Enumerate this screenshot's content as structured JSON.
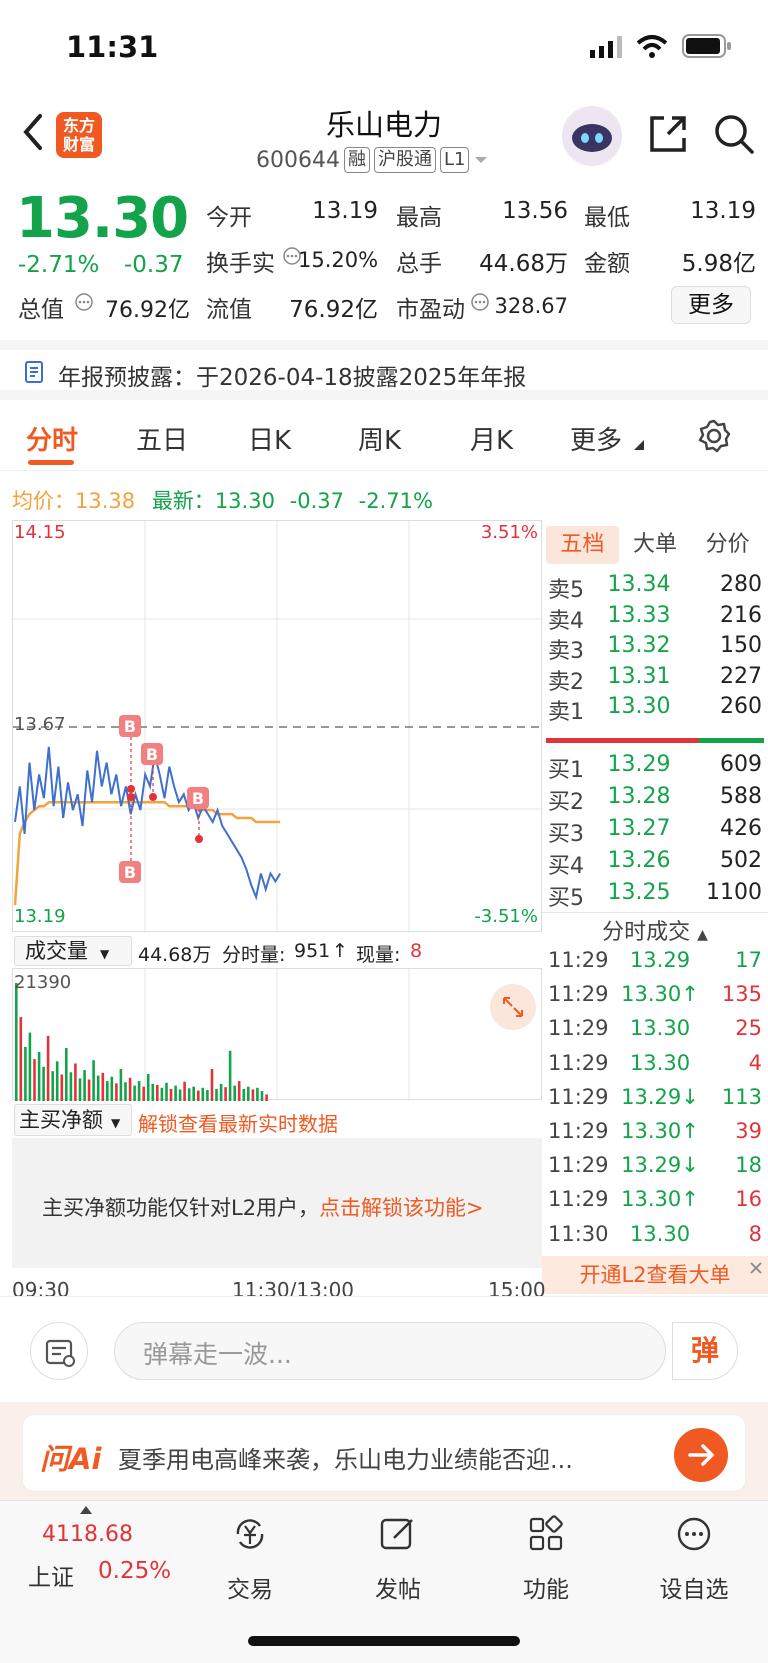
{
  "status": {
    "time": "11:31"
  },
  "header": {
    "logo_line1": "东方",
    "logo_line2": "财富",
    "name": "乐山电力",
    "code": "600644",
    "tags": [
      "融",
      "沪股通",
      "L1"
    ]
  },
  "quote": {
    "price": "13.30",
    "pct": "-2.71%",
    "change": "-0.37",
    "stats": [
      {
        "label": "今开",
        "value": "13.19",
        "color": "#13a34a"
      },
      {
        "label": "最高",
        "value": "13.56",
        "color": "#13a34a"
      },
      {
        "label": "最低",
        "value": "13.19",
        "color": "#13a34a"
      },
      {
        "label": "换手实",
        "value": "15.20%",
        "color": "#222222"
      },
      {
        "label": "总手",
        "value": "44.68万",
        "color": "#222222"
      },
      {
        "label": "金额",
        "value": "5.98亿",
        "color": "#222222"
      },
      {
        "label": "总值",
        "value": "76.92亿",
        "color": "#222222"
      },
      {
        "label": "流值",
        "value": "76.92亿",
        "color": "#222222"
      },
      {
        "label": "市盈动",
        "value": "328.67",
        "color": "#222222"
      }
    ],
    "more": "更多"
  },
  "notice": "年报预披露：于2026-04-18披露2025年年报",
  "tabs": [
    "分时",
    "五日",
    "日K",
    "周K",
    "月K",
    "更多"
  ],
  "avg_row": {
    "avg_label": "均价：",
    "avg_value": "13.38",
    "latest_label": "最新：",
    "latest_value": "13.30",
    "change": "-0.37",
    "pct": "-2.71%"
  },
  "chart_data": {
    "type": "line",
    "y_top": "14.15",
    "y_bottom": "13.19",
    "y_ref": "13.67",
    "pct_top": "3.51%",
    "pct_bottom": "-3.51%",
    "ylim": [
      13.19,
      14.15
    ],
    "x_labels": [
      "09:30",
      "11:30/13:00",
      "15:00"
    ],
    "price_series": [
      13.43,
      13.52,
      13.4,
      13.58,
      13.46,
      13.55,
      13.49,
      13.62,
      13.47,
      13.57,
      13.44,
      13.53,
      13.46,
      13.5,
      13.42,
      13.56,
      13.48,
      13.61,
      13.52,
      13.58,
      13.5,
      13.55,
      13.47,
      13.52,
      13.45,
      13.5,
      13.46,
      13.55,
      13.52,
      13.6,
      13.55,
      13.49,
      13.57,
      13.52,
      13.48,
      13.5,
      13.46,
      13.48,
      13.44,
      13.47,
      13.45,
      13.43,
      13.46,
      13.42,
      13.4,
      13.38,
      13.36,
      13.34,
      13.31,
      13.27,
      13.24,
      13.3,
      13.26,
      13.3,
      13.28,
      13.3
    ],
    "avg_series": [
      13.22,
      13.4,
      13.43,
      13.45,
      13.46,
      13.47,
      13.47,
      13.48,
      13.48,
      13.48,
      13.48,
      13.48,
      13.48,
      13.48,
      13.48,
      13.48,
      13.48,
      13.48,
      13.48,
      13.48,
      13.48,
      13.48,
      13.48,
      13.48,
      13.48,
      13.48,
      13.48,
      13.48,
      13.48,
      13.48,
      13.48,
      13.48,
      13.47,
      13.47,
      13.47,
      13.47,
      13.47,
      13.47,
      13.46,
      13.46,
      13.46,
      13.46,
      13.45,
      13.45,
      13.45,
      13.45,
      13.44,
      13.44,
      13.44,
      13.44,
      13.43,
      13.43,
      13.43,
      13.43,
      13.43,
      13.43
    ],
    "buy_markers": [
      "B",
      "B",
      "B",
      "B"
    ]
  },
  "order_book": {
    "tabs": [
      "五档",
      "大单",
      "分价"
    ],
    "asks": [
      {
        "label": "卖5",
        "price": "13.34",
        "vol": "280"
      },
      {
        "label": "卖4",
        "price": "13.33",
        "vol": "216"
      },
      {
        "label": "卖3",
        "price": "13.32",
        "vol": "150"
      },
      {
        "label": "卖2",
        "price": "13.31",
        "vol": "227"
      },
      {
        "label": "卖1",
        "price": "13.30",
        "vol": "260"
      }
    ],
    "bids": [
      {
        "label": "买1",
        "price": "13.29",
        "vol": "609"
      },
      {
        "label": "买2",
        "price": "13.28",
        "vol": "588"
      },
      {
        "label": "买3",
        "price": "13.27",
        "vol": "426"
      },
      {
        "label": "买4",
        "price": "13.26",
        "vol": "502"
      },
      {
        "label": "买5",
        "price": "13.25",
        "vol": "1100"
      }
    ],
    "ticks_title": "分时成交",
    "ticks": [
      {
        "time": "11:29",
        "price": "13.29",
        "arrow": "",
        "vol": "17",
        "pc": "#13a34a",
        "vc": "#13a34a"
      },
      {
        "time": "11:29",
        "price": "13.30",
        "arrow": "↑",
        "vol": "135",
        "pc": "#13a34a",
        "vc": "#e2333a"
      },
      {
        "time": "11:29",
        "price": "13.30",
        "arrow": "",
        "vol": "25",
        "pc": "#13a34a",
        "vc": "#e2333a"
      },
      {
        "time": "11:29",
        "price": "13.30",
        "arrow": "",
        "vol": "4",
        "pc": "#13a34a",
        "vc": "#e2333a"
      },
      {
        "time": "11:29",
        "price": "13.29",
        "arrow": "↓",
        "vol": "113",
        "pc": "#13a34a",
        "vc": "#13a34a"
      },
      {
        "time": "11:29",
        "price": "13.30",
        "arrow": "↑",
        "vol": "39",
        "pc": "#13a34a",
        "vc": "#e2333a"
      },
      {
        "time": "11:29",
        "price": "13.29",
        "arrow": "↓",
        "vol": "18",
        "pc": "#13a34a",
        "vc": "#13a34a"
      },
      {
        "time": "11:29",
        "price": "13.30",
        "arrow": "↑",
        "vol": "16",
        "pc": "#13a34a",
        "vc": "#e2333a"
      },
      {
        "time": "11:30",
        "price": "13.30",
        "arrow": "",
        "vol": "8",
        "pc": "#13a34a",
        "vc": "#e2333a"
      }
    ],
    "l2_banner": "开通L2查看大单"
  },
  "volume": {
    "selector": "成交量",
    "total": "44.68万",
    "minute_label": "分时量:",
    "minute_value": "951",
    "minute_arrow": "↑",
    "now_label": "现量:",
    "now_value": "8",
    "max": "21390",
    "bars": [
      21390,
      15200,
      9800,
      12400,
      7600,
      8900,
      6200,
      11800,
      5400,
      7200,
      4800,
      9600,
      5200,
      6800,
      4100,
      5600,
      3900,
      7400,
      4600,
      5100,
      3600,
      4400,
      3200,
      5800,
      3400,
      4200,
      2800,
      3600,
      2600,
      4900,
      3100,
      2900,
      2400,
      3300,
      2200,
      2800,
      2100,
      3500,
      2300,
      2600,
      1900,
      2400,
      2000,
      5800,
      2200,
      3100,
      2500,
      9100,
      2800,
      3600,
      2200,
      2600,
      2100,
      2400,
      1800,
      1200
    ]
  },
  "net_flow": {
    "selector": "主买净额",
    "unlock_link": "解锁查看最新实时数据",
    "msg": "主买净额功能仅针对L2用户，",
    "msg_link": "点击解锁该功能>"
  },
  "comment": {
    "placeholder": "弹幕走一波...",
    "danmu": "弹"
  },
  "ai": {
    "logo": "问Ai",
    "text": "夏季用电高峰来袭，乐山电力业绩能否迎..."
  },
  "tabbar": {
    "index_value": "4118.68",
    "index_name": "上证",
    "index_pct": "0.25%",
    "items": [
      "交易",
      "发帖",
      "功能",
      "设自选"
    ]
  }
}
